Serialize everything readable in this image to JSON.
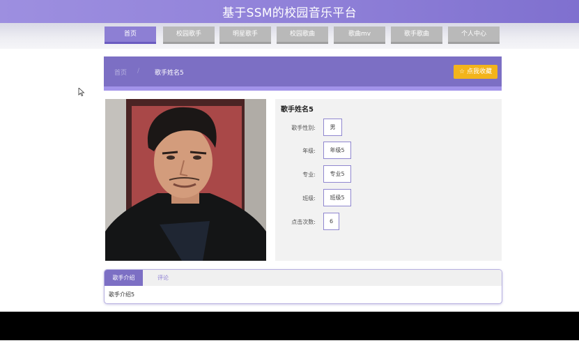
{
  "header": {
    "title": "基于SSM的校园音乐平台"
  },
  "nav": {
    "items": [
      "首页",
      "校园歌手",
      "明星歌手",
      "校园歌曲",
      "歌曲mv",
      "歌手歌曲",
      "个人中心"
    ],
    "active_index": 0
  },
  "breadcrumb": {
    "home": "首页",
    "separator": "/",
    "current": "歌手姓名5"
  },
  "favorite_button": {
    "icon": "star-outline-icon",
    "label": "☆ 点我收藏"
  },
  "singer": {
    "name": "歌手姓名5",
    "photo_alt": "singer-photo",
    "fields": [
      {
        "label": "歌手性别:",
        "value": "男"
      },
      {
        "label": "年级:",
        "value": "年级5"
      },
      {
        "label": "专业:",
        "value": "专业5"
      },
      {
        "label": "班级:",
        "value": "班级5"
      },
      {
        "label": "点击次数:",
        "value": "6"
      }
    ]
  },
  "tabs": {
    "items": [
      "歌手介绍",
      "评论"
    ],
    "active_index": 0,
    "content": "歌手介绍5"
  },
  "colors": {
    "accent": "#7c6fc4",
    "nav_active": "#8d7fd4",
    "nav_inactive": "#b9b9b9",
    "favorite": "#f3b41b"
  }
}
